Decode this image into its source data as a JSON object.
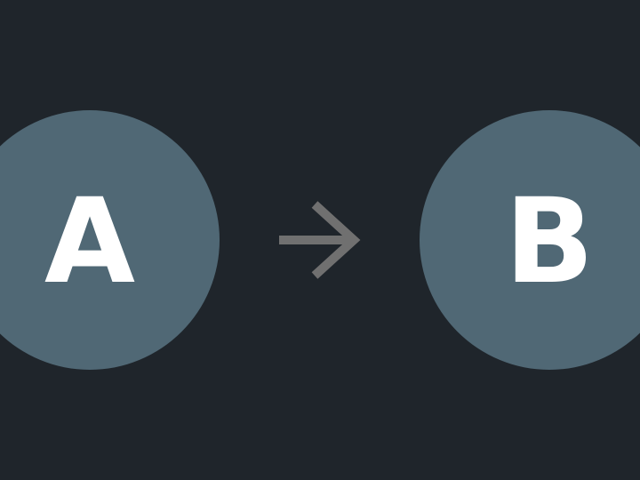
{
  "diagram": {
    "nodes": [
      {
        "label": "A"
      },
      {
        "label": "B"
      }
    ],
    "edges": [
      {
        "from": "A",
        "to": "B",
        "icon": "arrow-right-icon"
      }
    ]
  },
  "colors": {
    "background": "#1f252b",
    "node_fill": "#506875",
    "node_text": "#ffffff",
    "arrow": "#707070"
  }
}
